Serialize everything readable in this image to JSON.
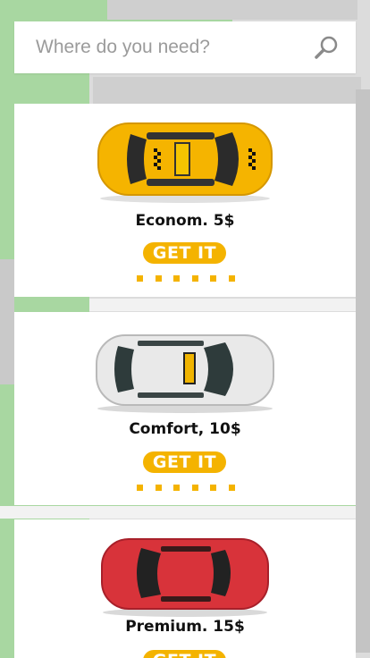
{
  "search": {
    "placeholder": "Where do you need?",
    "icon": "search-icon"
  },
  "options": [
    {
      "name": "Econom. 5$",
      "button": "GET IT",
      "car_color": "#f5b400",
      "has_taxi_sign": true
    },
    {
      "name": "Comfort, 10$",
      "button": "GET IT",
      "car_color": "#e6e6e6",
      "has_taxi_sign": true
    },
    {
      "name": "Premium. 15$",
      "button": "GET IT",
      "car_color": "#d8333a",
      "has_taxi_sign": false
    }
  ],
  "colors": {
    "accent": "#f4b300",
    "card": "#ffffff",
    "map_green": "#a8d7a1"
  }
}
